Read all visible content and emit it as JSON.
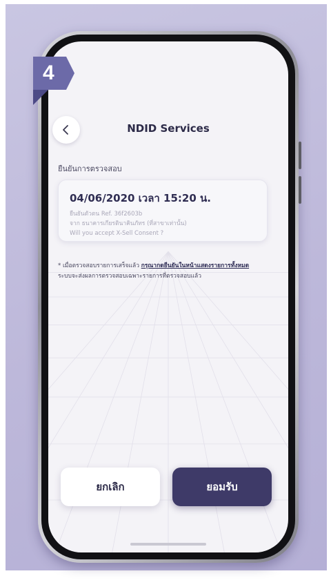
{
  "step": {
    "number": "4"
  },
  "header": {
    "title": "NDID Services",
    "back_icon": "chevron-left-icon"
  },
  "section": {
    "title": "ยืนยันการตรวจสอบ"
  },
  "card": {
    "datetime": "04/06/2020 เวลา 15:20 น.",
    "ref": "ยืนยันตัวตน Ref. 36f2603b",
    "source": "จาก ธนาคารเกียรตินาคินภัทร (ที่สาขาเท่านั้น)",
    "question": "Will you accept X-Sell Consent ?"
  },
  "note": {
    "prefix": "* เมื่อตรวจสอบรายการเสร็จแล้ว ",
    "link": "กรุณากดยืนยันในหน้าแสดงรายการทั้งหมด",
    "suffix": " ระบบจะส่งผลการตรวจสอบเฉพาะรายการที่ตรวจสอบแล้ว"
  },
  "buttons": {
    "cancel": "ยกเลิก",
    "accept": "ยอมรับ"
  },
  "colors": {
    "accent": "#3e3a68",
    "badge": "#6c6aa8",
    "background": "#c9c6e2"
  }
}
